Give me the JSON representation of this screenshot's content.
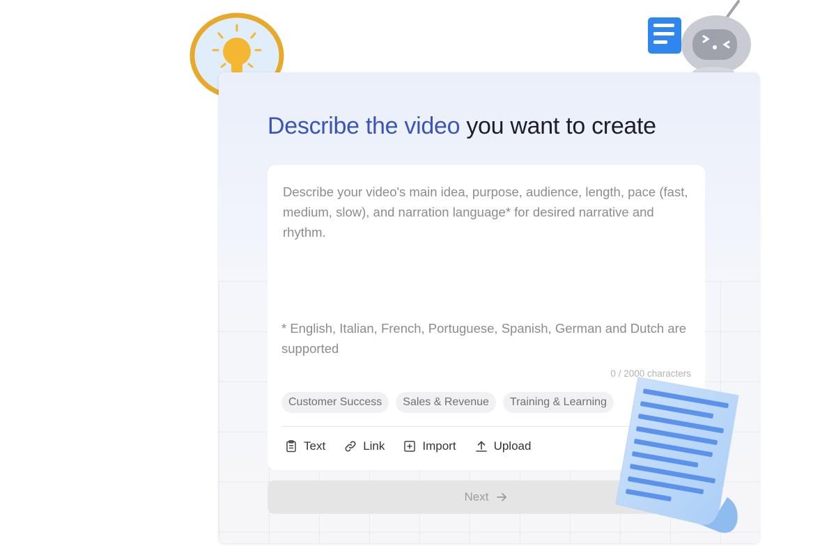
{
  "prompt": {
    "title_accent": "Describe the video",
    "title_rest": "you want to create",
    "placeholder": "Describe your video's main idea, purpose, audience, length, pace (fast, medium, slow), and narration language* for desired narrative and rhythm.",
    "value": "",
    "note": "* English, Italian, French, Portuguese, Spanish, German and Dutch are supported",
    "counter": "0 / 2000 characters"
  },
  "chips": [
    "Customer Success",
    "Sales & Revenue",
    "Training & Learning"
  ],
  "tools": {
    "text": {
      "label": "Text",
      "icon": "clipboard-icon"
    },
    "link": {
      "label": "Link",
      "icon": "link-icon"
    },
    "import": {
      "label": "Import",
      "icon": "plus-square-icon"
    },
    "upload": {
      "label": "Upload",
      "icon": "upload-icon"
    }
  },
  "next": {
    "label": "Next",
    "icon": "arrow-right-icon",
    "enabled": false
  },
  "illustrations": [
    "lightbulb-icon",
    "robot-icon",
    "document-icon"
  ],
  "colors": {
    "title_accent": "#3a55b8",
    "title": "#1c1f2b",
    "bulb": "#f5b731",
    "bulb_ring": "#e8a92a",
    "robot_note": "#2f86ef",
    "document": "#a9cdf6"
  }
}
